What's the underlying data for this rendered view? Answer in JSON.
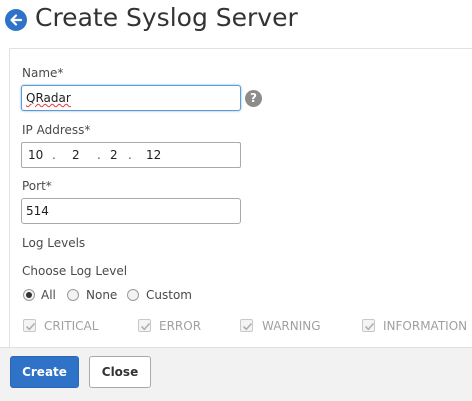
{
  "header": {
    "title": "Create Syslog Server",
    "back_icon": "arrow-left-icon"
  },
  "form": {
    "name": {
      "label": "Name*",
      "value": "QRadar",
      "help": "?"
    },
    "ip": {
      "label": "IP Address*",
      "octets": [
        "10",
        "2",
        "2",
        "12"
      ],
      "separator": "."
    },
    "port": {
      "label": "Port*",
      "value": "514"
    },
    "log_levels_label": "Log Levels",
    "choose_log_level_label": "Choose Log Level",
    "options": [
      "All",
      "None",
      "Custom"
    ],
    "selected_option": "All",
    "levels": [
      "CRITICAL",
      "ERROR",
      "WARNING",
      "INFORMATION"
    ]
  },
  "footer": {
    "create_label": "Create",
    "close_label": "Close"
  },
  "colors": {
    "accent": "#2f73c9",
    "disabled_text": "#a0a0a0"
  }
}
